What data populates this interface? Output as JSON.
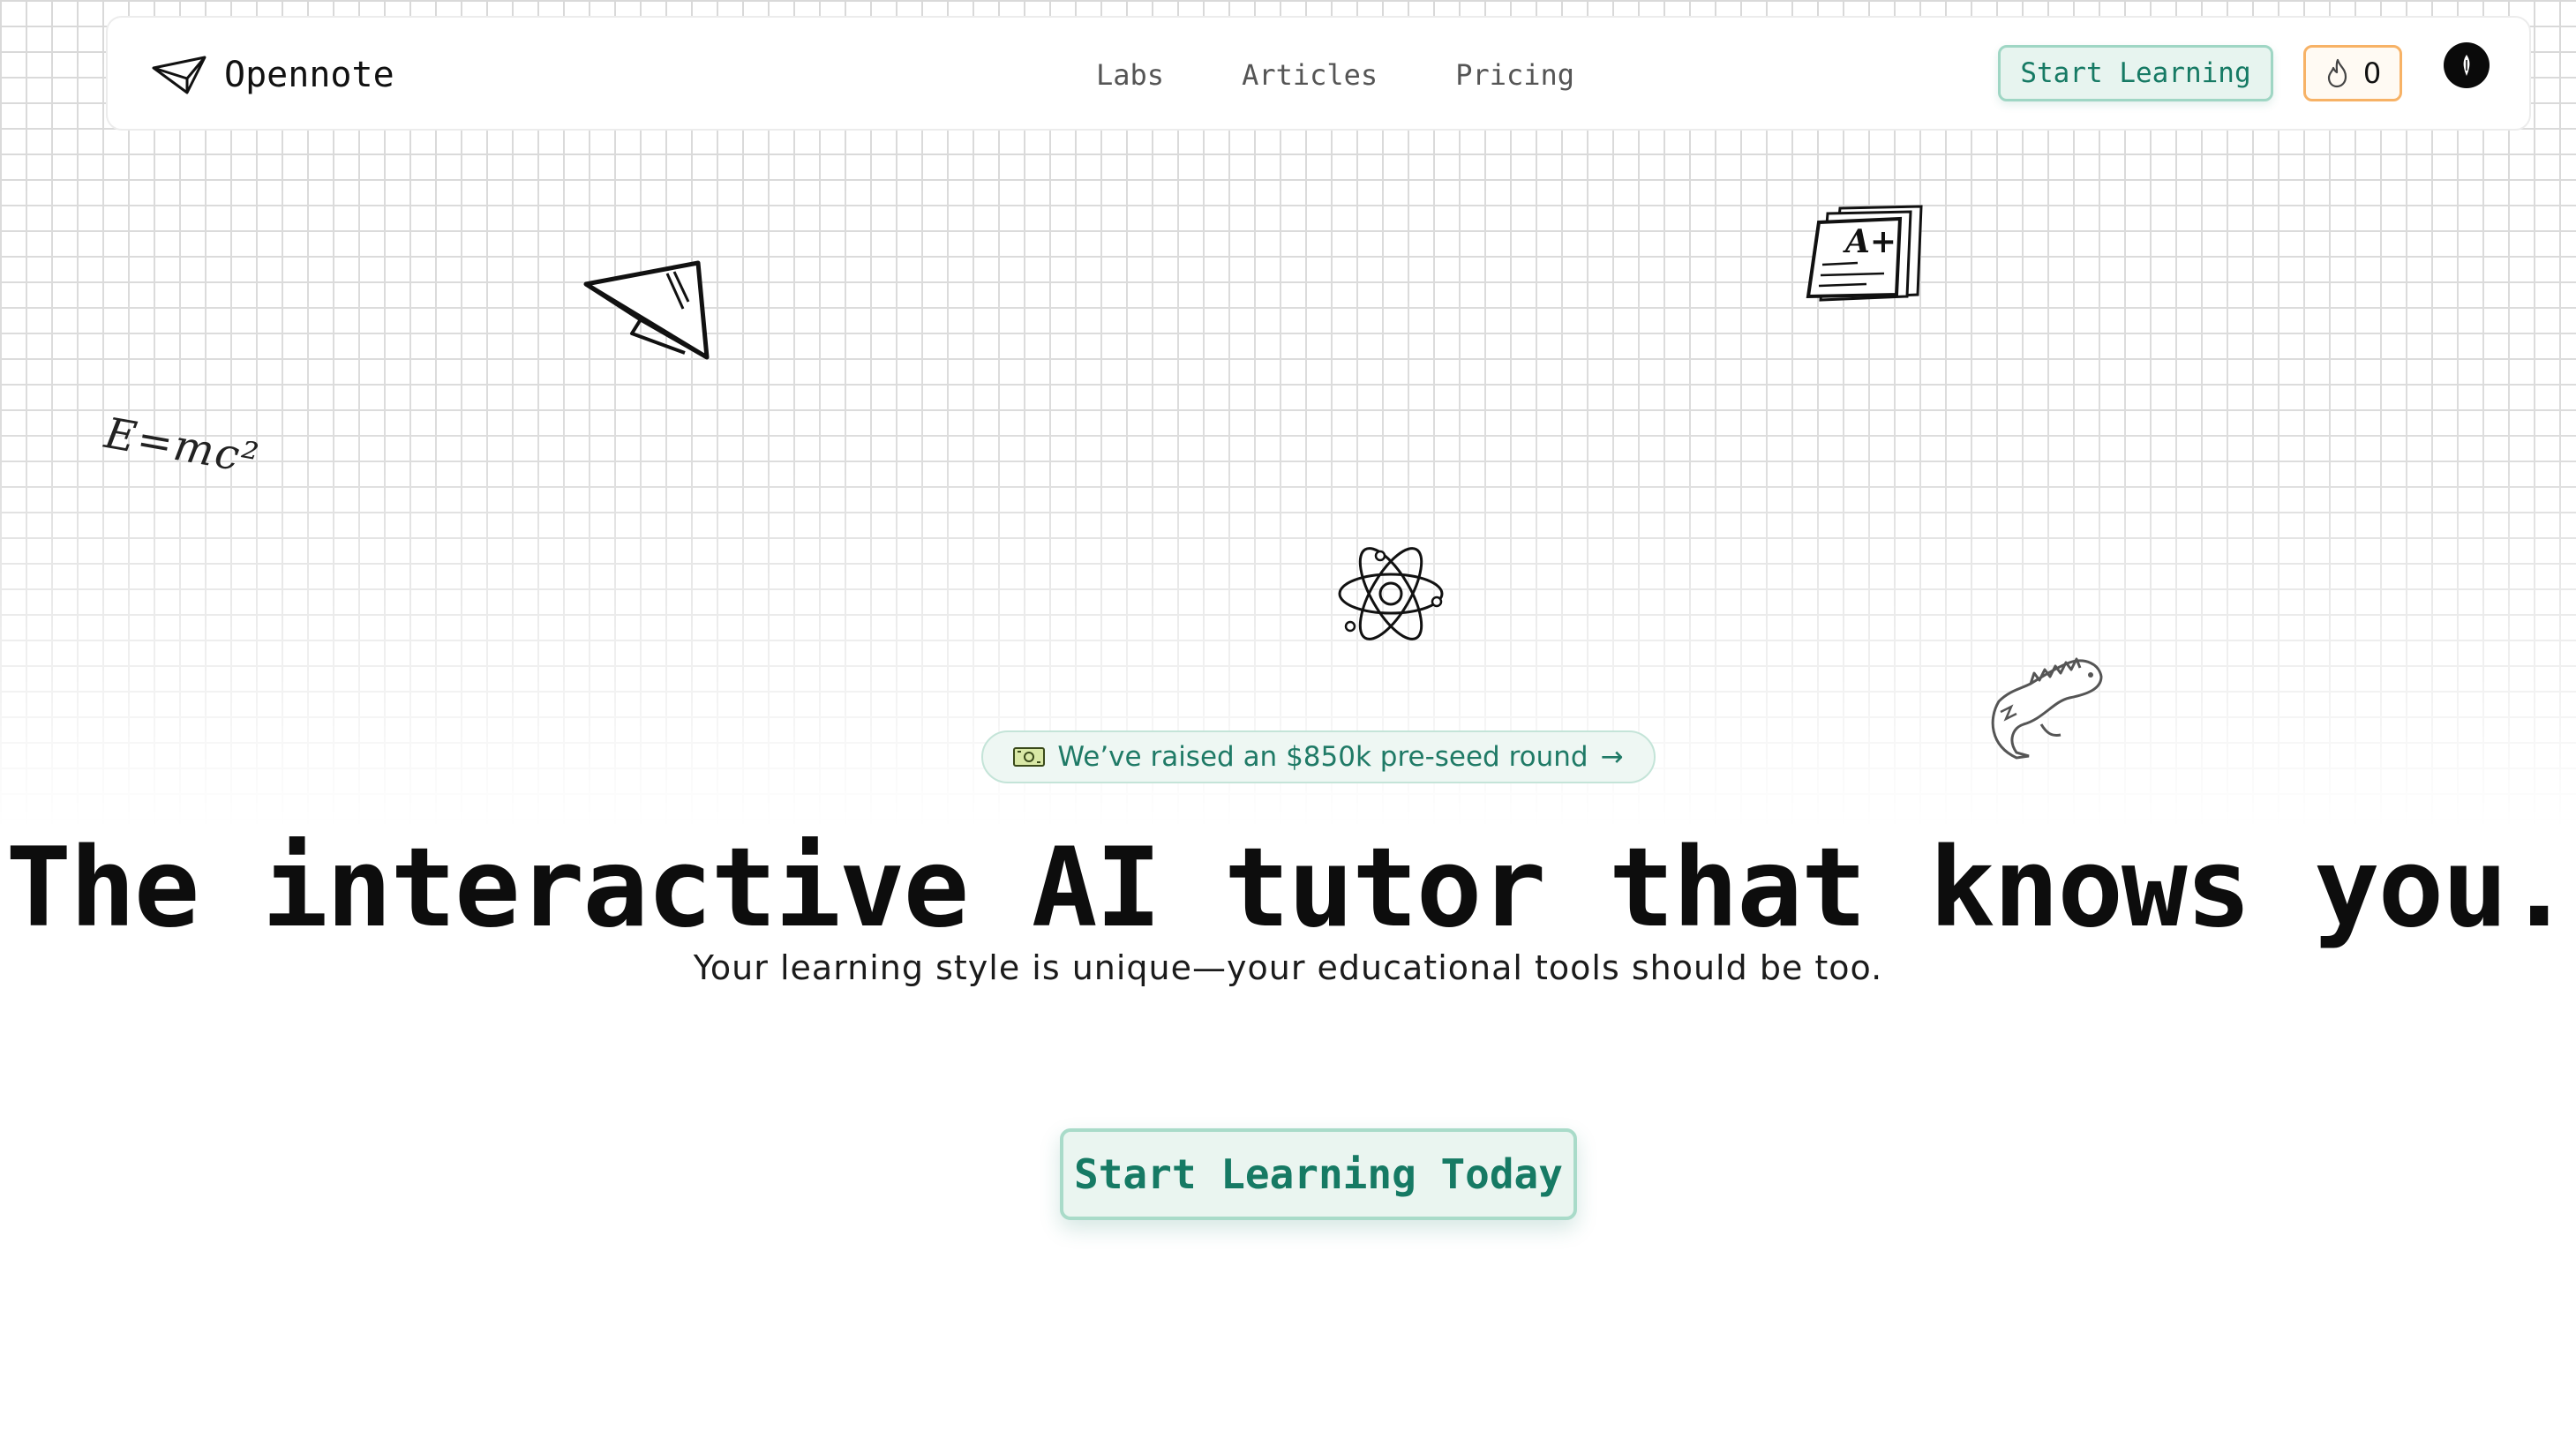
{
  "brand": {
    "name": "Opennote"
  },
  "nav": {
    "links": [
      "Labs",
      "Articles",
      "Pricing"
    ],
    "start_label": "Start Learning",
    "streak_count": "0"
  },
  "doodles": {
    "equation": "E=mc²",
    "grade": "A+"
  },
  "announcement": {
    "text": "We’ve raised an $850k pre-seed round",
    "arrow": "→"
  },
  "hero": {
    "title": "The interactive AI tutor that knows you.",
    "subtitle": "Your learning style is unique—your educational tools should be too.",
    "cta_label": "Start Learning Today"
  },
  "colors": {
    "accent": "#167a64",
    "accent_bg": "#e7f4ef",
    "streak_border": "#f7b266"
  }
}
